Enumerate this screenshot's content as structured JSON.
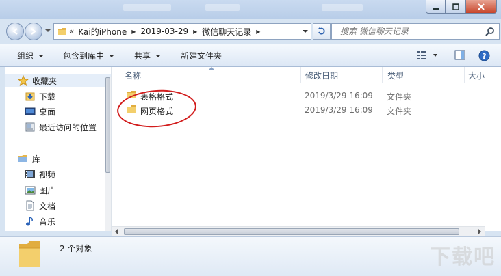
{
  "window": {
    "controls": {
      "minimize_icon": "minimize-icon",
      "maximize_icon": "maximize-icon",
      "close_icon": "close-icon"
    }
  },
  "address": {
    "overflow": "«",
    "crumbs": [
      "Kai的iPhone",
      "2019-03-29",
      "微信聊天记录"
    ]
  },
  "search": {
    "placeholder": "搜索 微信聊天记录"
  },
  "toolbar": {
    "organize": "组织",
    "include_in_library": "包含到库中",
    "share": "共享",
    "new_folder": "新建文件夹"
  },
  "sidebar": {
    "favorites": "收藏夹",
    "favorites_items": [
      "下载",
      "桌面",
      "最近访问的位置"
    ],
    "libraries": "库",
    "library_items": [
      "视频",
      "图片",
      "文档",
      "音乐"
    ]
  },
  "columns": {
    "name": "名称",
    "date_modified": "修改日期",
    "type": "类型",
    "size": "大小"
  },
  "files": [
    {
      "name": "表格格式",
      "date": "2019/3/29 16:09",
      "type": "文件夹"
    },
    {
      "name": "网页格式",
      "date": "2019/3/29 16:09",
      "type": "文件夹"
    }
  ],
  "details": {
    "count": "2 个对象"
  },
  "watermark": "下载吧",
  "colors": {
    "annotation_circle": "#d21d1d",
    "toolbar_bg": "#dce7f5",
    "folder": "#f2c75c"
  }
}
